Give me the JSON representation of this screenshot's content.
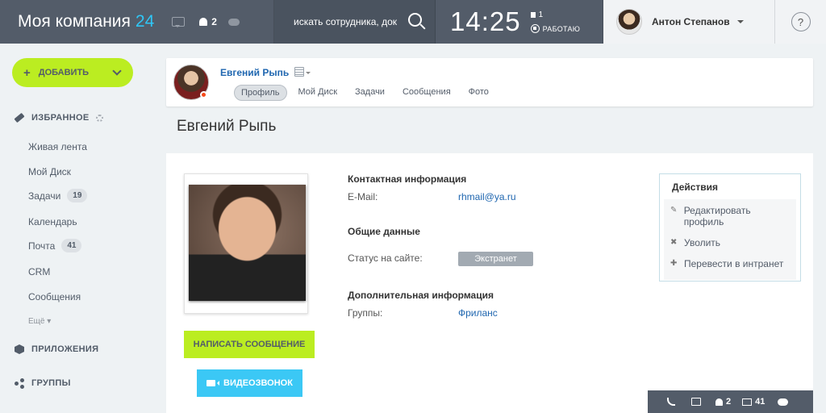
{
  "header": {
    "logo_name": "Моя компания",
    "logo_number": "24",
    "notifications_count": "2",
    "search_placeholder": "искать сотрудника, док",
    "time": "14:25",
    "flag_count": "1",
    "work_status": "РАБОТАЮ",
    "user_name": "Антон Степанов",
    "help_label": "?"
  },
  "sidebar": {
    "add_label": "ДОБАВИТЬ",
    "favorites_label": "ИЗБРАННОЕ",
    "items": [
      {
        "label": "Живая лента"
      },
      {
        "label": "Мой Диск"
      },
      {
        "label": "Задачи",
        "count": "19"
      },
      {
        "label": "Календарь"
      },
      {
        "label": "Почта",
        "count": "41"
      },
      {
        "label": "CRM"
      },
      {
        "label": "Сообщения"
      }
    ],
    "more_label": "Ещё",
    "apps_label": "ПРИЛОЖЕНИЯ",
    "groups_label": "ГРУППЫ"
  },
  "profile_header": {
    "name": "Евгений Рыпь",
    "tabs": [
      {
        "label": "Профиль",
        "active": true
      },
      {
        "label": "Мой Диск"
      },
      {
        "label": "Задачи"
      },
      {
        "label": "Сообщения"
      },
      {
        "label": "Фото"
      }
    ]
  },
  "page_title": "Евгений Рыпь",
  "profile": {
    "contact_heading": "Контактная информация",
    "email_label": "E-Mail:",
    "email_value": "rhmail@ya.ru",
    "general_heading": "Общие данные",
    "status_label": "Статус на сайте:",
    "status_value": "Экстранет",
    "extra_heading": "Дополнительная информация",
    "groups_label": "Группы:",
    "groups_value": "Фриланс",
    "message_button": "НАПИСАТЬ СООБЩЕНИЕ",
    "video_button": "ВИДЕОЗВОНОК"
  },
  "actions": {
    "title": "Действия",
    "items": [
      {
        "label": "Редактировать профиль",
        "icon": "pencil-icon"
      },
      {
        "label": "Уволить",
        "icon": "cross-icon"
      },
      {
        "label": "Перевести в интранет",
        "icon": "plus-icon"
      }
    ]
  },
  "bottom_bar": {
    "notifications_count": "2",
    "mail_count": "41"
  },
  "colors": {
    "header_bg": "#535c69",
    "accent_green": "#bbed21",
    "accent_blue": "#3bc8f5",
    "link_blue": "#2067b0"
  }
}
